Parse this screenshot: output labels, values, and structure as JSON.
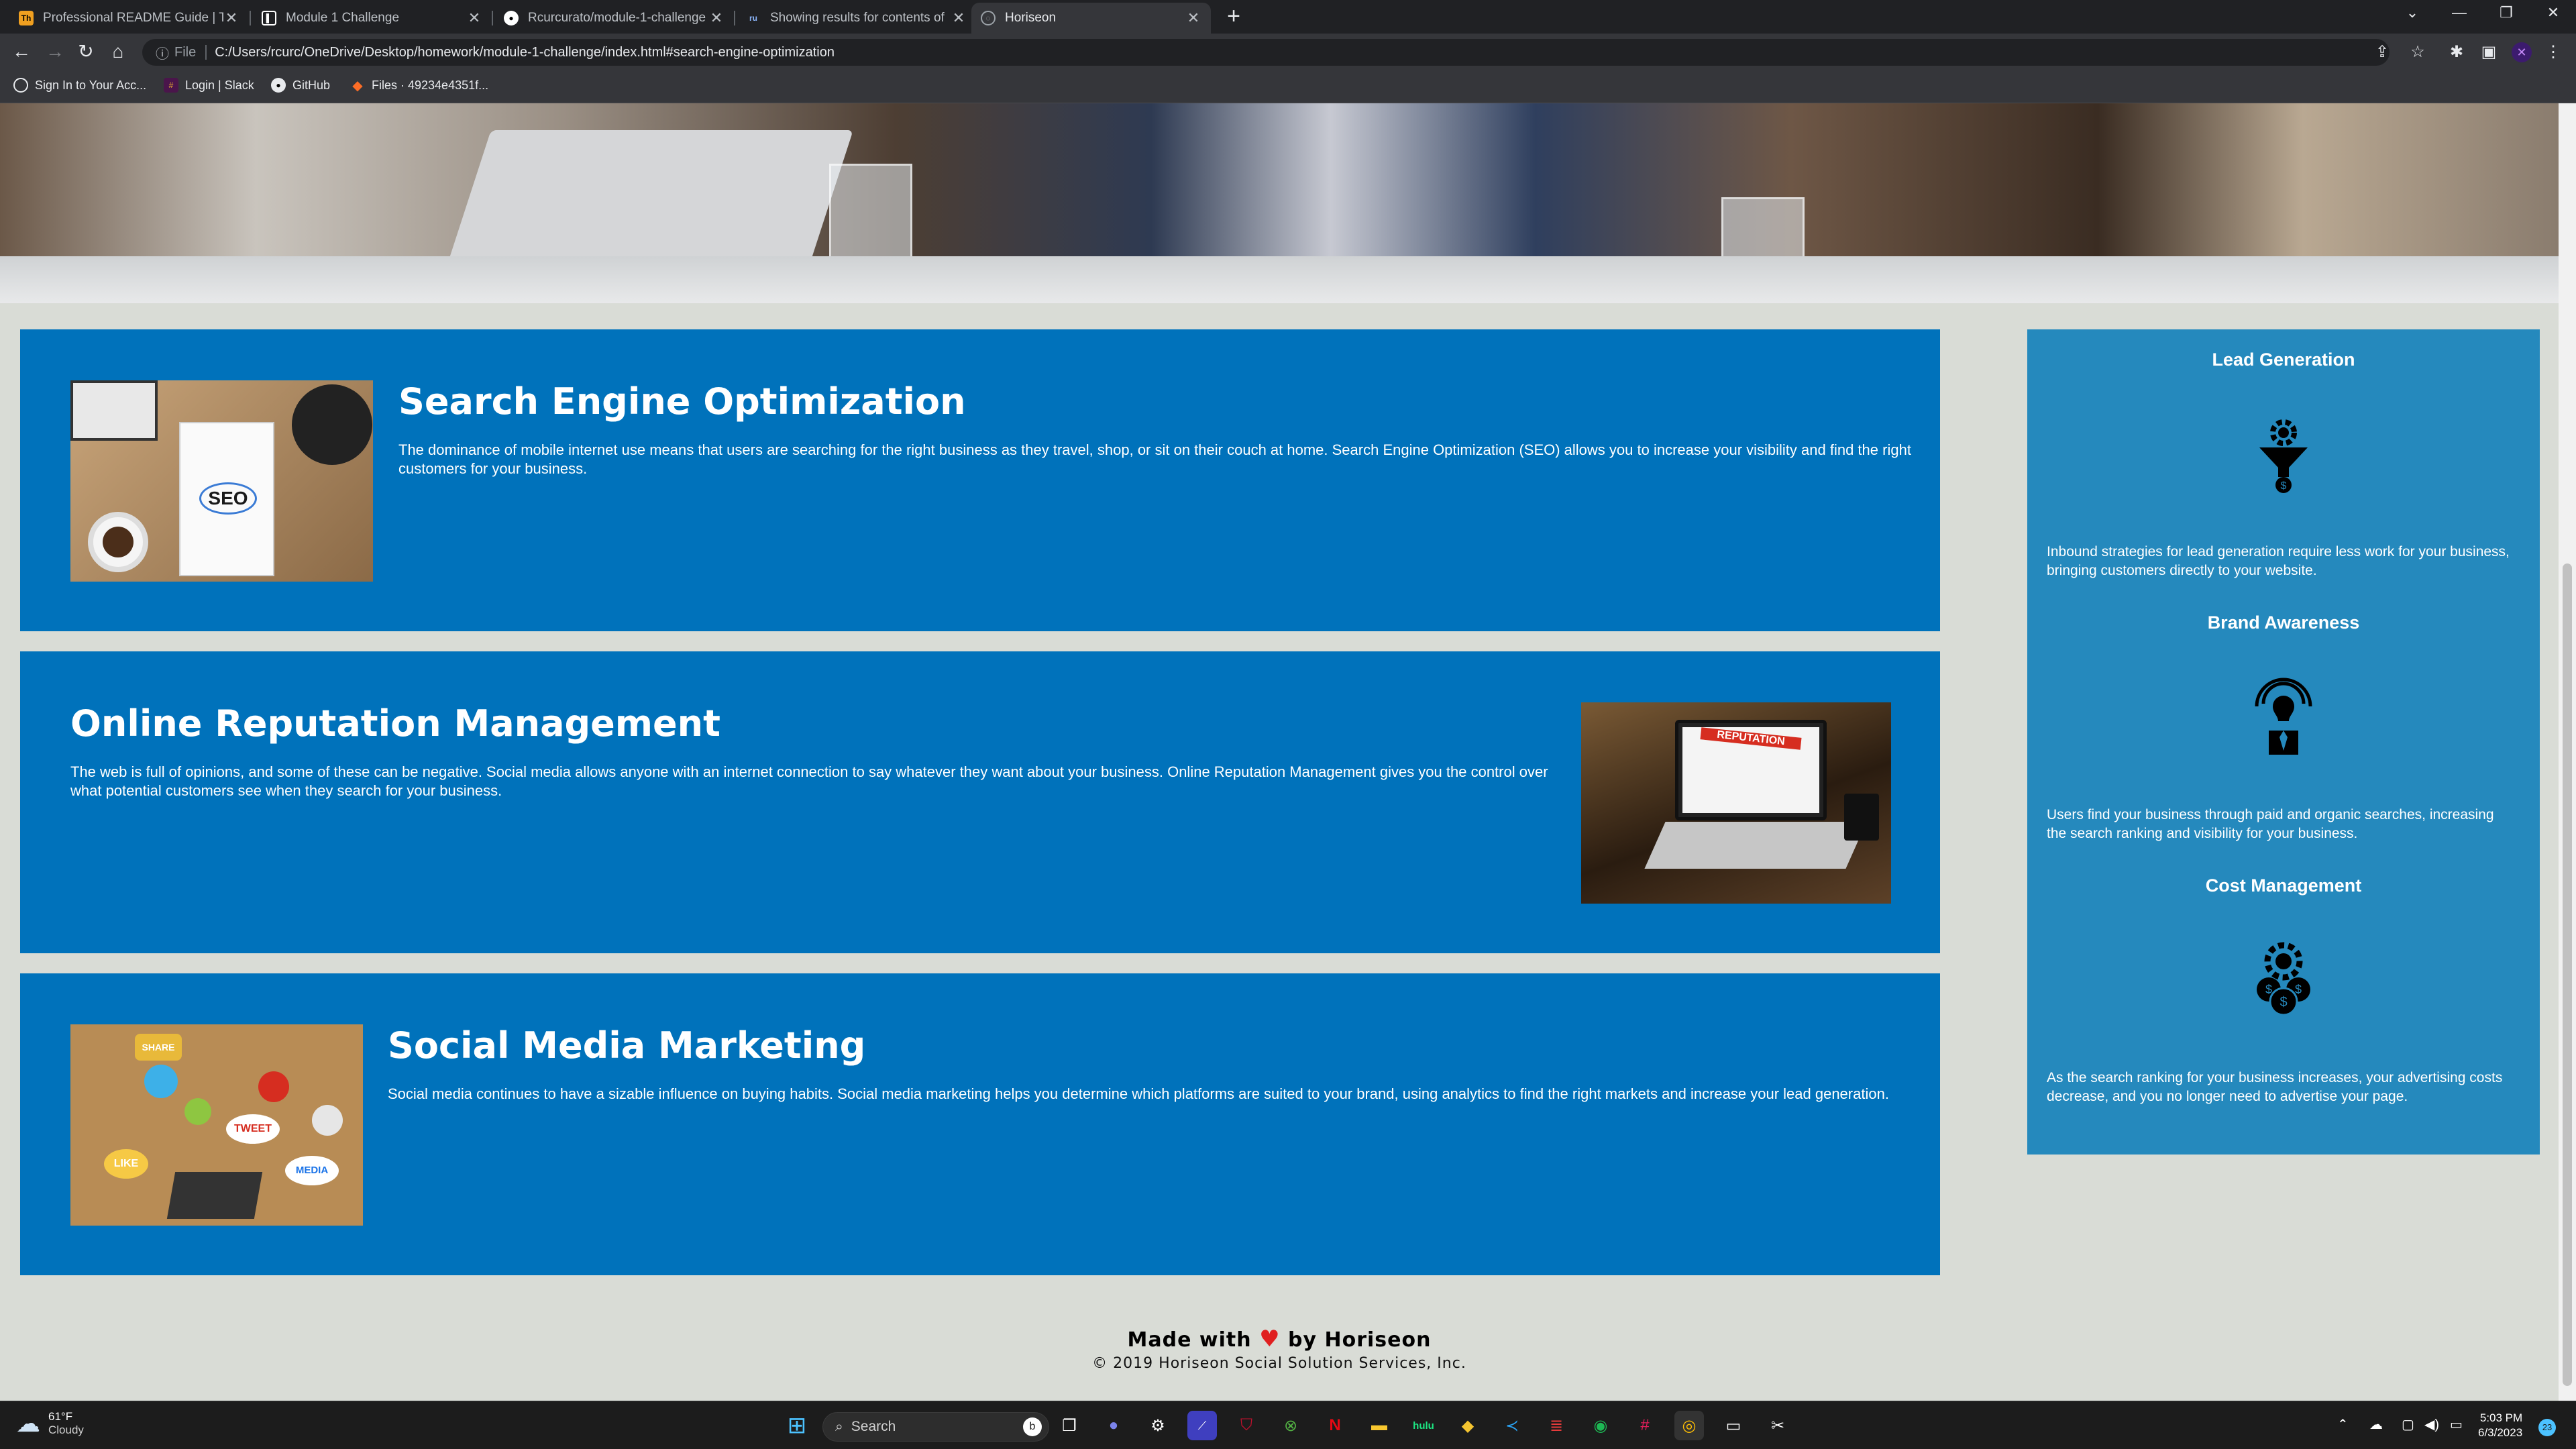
{
  "browser": {
    "tabs": [
      {
        "title": "Professional README Guide | Th",
        "active": false,
        "favicon": "readme-icon",
        "favicon_color": "#f0a020"
      },
      {
        "title": "Module 1 Challenge",
        "active": false,
        "favicon": "doc-icon",
        "favicon_color": "#ffffff"
      },
      {
        "title": "Rcurcurato/module-1-challenge",
        "active": false,
        "favicon": "github-icon",
        "favicon_color": "#ffffff"
      },
      {
        "title": "Showing results for contents of ",
        "active": false,
        "favicon": "search-icon",
        "favicon_color": "#8ab4f8"
      },
      {
        "title": "Horiseon",
        "active": true,
        "favicon": "globe-icon",
        "favicon_color": "#9aa0a6"
      }
    ],
    "file_label": "File",
    "url": "C:/Users/rcurc/OneDrive/Desktop/homework/module-1-challenge/index.html#search-engine-optimization",
    "bookmarks": [
      {
        "label": "Sign In to Your Acc...",
        "icon": "globe-icon"
      },
      {
        "label": "Login | Slack",
        "icon": "slack-icon"
      },
      {
        "label": "GitHub",
        "icon": "github-icon"
      },
      {
        "label": "Files · 49234e4351f...",
        "icon": "gitlab-icon"
      }
    ]
  },
  "page": {
    "sections": [
      {
        "id": "search-engine-optimization",
        "title": "Search Engine Optimization",
        "text": "The dominance of mobile internet use means that users are searching for the right business as they travel, shop, or sit on their couch at home. Search Engine Optimization (SEO) allows you to increase your visibility and find the right customers for your business.",
        "image": "seo-image",
        "image_word": "SEO"
      },
      {
        "id": "online-reputation-management",
        "title": "Online Reputation Management",
        "text": "The web is full of opinions, and some of these can be negative. Social media allows anyone with an internet connection to say whatever they want about your business. Online Reputation Management gives you the control over what potential customers see when they search for your business.",
        "image": "reputation-image",
        "image_word": "REPUTATION"
      },
      {
        "id": "social-media-marketing",
        "title": "Social Media Marketing",
        "text": "Social media continues to have a sizable influence on buying habits. Social media marketing helps you determine which platforms are suited to your brand, using analytics to find the right markets and increase your lead generation.",
        "image": "social-media-image",
        "image_words": [
          "SHARE",
          "TWEET",
          "LIKE",
          "MEDIA"
        ]
      }
    ],
    "benefits": [
      {
        "title": "Lead Generation",
        "icon": "lead-generation-icon",
        "text": "Inbound strategies for lead generation require less work for your business, bringing customers directly to your website."
      },
      {
        "title": "Brand Awareness",
        "icon": "brand-awareness-icon",
        "text": "Users find your business through paid and organic searches, increasing the search ranking and visibility for your business."
      },
      {
        "title": "Cost Management",
        "icon": "cost-management-icon",
        "text": "As the search ranking for your business increases, your advertising costs decrease, and you no longer need to advertise your page."
      }
    ],
    "footer": {
      "made_with": "Made with",
      "by": "by Horiseon",
      "copyright": "© 2019 Horiseon Social Solution Services, Inc."
    },
    "colors": {
      "card_blue": "#0072bb",
      "benefits_blue": "#2589bd",
      "page_bg": "#d9dcd6",
      "heart": "#e02020"
    }
  },
  "taskbar": {
    "weather_temp": "61°F",
    "weather_desc": "Cloudy",
    "search_placeholder": "Search",
    "time": "5:03 PM",
    "date": "6/3/2023",
    "notification_count": "23"
  }
}
